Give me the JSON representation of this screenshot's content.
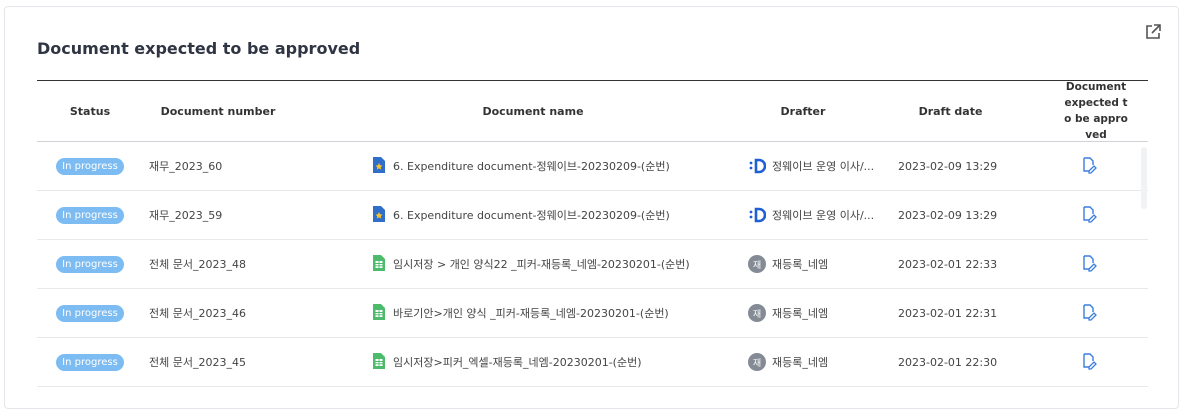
{
  "panel": {
    "title": "Document expected to be approved"
  },
  "columns": {
    "status": "Status",
    "number": "Document number",
    "name": "Document name",
    "drafter": "Drafter",
    "date": "Draft date",
    "approve": "Document expected to be approved"
  },
  "rows": [
    {
      "status": "In progress",
      "number": "재무_2023_60",
      "name": "6. Expenditure document-정웨이브-20230209-(순번)",
      "doc_icon": "starred-doc-icon",
      "drafter": "정웨이브 운영 이사/...",
      "avatar": "logo",
      "avatar_text": "",
      "date": "2023-02-09 13:29"
    },
    {
      "status": "In progress",
      "number": "재무_2023_59",
      "name": "6. Expenditure document-정웨이브-20230209-(순번)",
      "doc_icon": "starred-doc-icon",
      "drafter": "정웨이브 운영 이사/...",
      "avatar": "logo",
      "avatar_text": "",
      "date": "2023-02-09 13:29"
    },
    {
      "status": "In progress",
      "number": "전체 문서_2023_48",
      "name": "임시저장 > 개인 양식22 _피커-재등록_네엠-20230201-(순번)",
      "doc_icon": "sheet-doc-icon",
      "drafter": "재등록_네엠",
      "avatar": "initial",
      "avatar_text": "재",
      "date": "2023-02-01 22:33"
    },
    {
      "status": "In progress",
      "number": "전체 문서_2023_46",
      "name": "바로기안>개인 양식 _피커-재등록_네엠-20230201-(순번)",
      "doc_icon": "sheet-doc-icon",
      "drafter": "재등록_네엠",
      "avatar": "initial",
      "avatar_text": "재",
      "date": "2023-02-01 22:31"
    },
    {
      "status": "In progress",
      "number": "전체 문서_2023_45",
      "name": "임시저장>피커_엑셀-재등록_네엠-20230201-(순번)",
      "doc_icon": "sheet-doc-icon",
      "drafter": "재등록_네엠",
      "avatar": "initial",
      "avatar_text": "재",
      "date": "2023-02-01 22:30"
    }
  ],
  "colors": {
    "badge": "#7cbcf2",
    "accent": "#3b7ddd",
    "sheet_green": "#4cbb6c"
  }
}
